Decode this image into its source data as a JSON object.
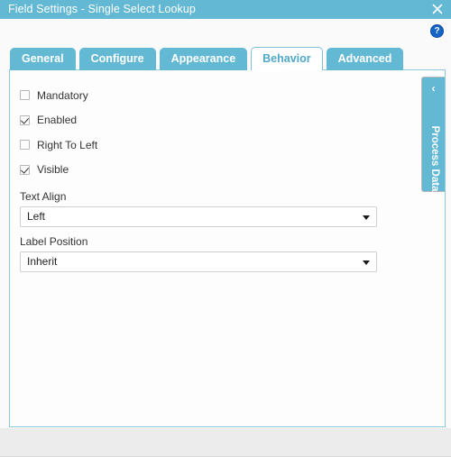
{
  "window": {
    "title": "Field Settings - Single Select Lookup",
    "close_icon": "close-icon",
    "help_icon": "help-icon",
    "help_glyph": "?"
  },
  "tabs": [
    {
      "label": "General",
      "active": false
    },
    {
      "label": "Configure",
      "active": false
    },
    {
      "label": "Appearance",
      "active": false
    },
    {
      "label": "Behavior",
      "active": true
    },
    {
      "label": "Advanced",
      "active": false
    }
  ],
  "form": {
    "checkboxes": [
      {
        "label": "Mandatory",
        "checked": false
      },
      {
        "label": "Enabled",
        "checked": true
      },
      {
        "label": "Right To Left",
        "checked": false
      },
      {
        "label": "Visible",
        "checked": true
      }
    ],
    "fields": [
      {
        "label": "Text Align",
        "value": "Left"
      },
      {
        "label": "Label Position",
        "value": "Inherit"
      }
    ]
  },
  "side_panel": {
    "label": "Process Data",
    "chevron": "‹",
    "chevron_icon": "chevron-left-icon"
  },
  "colors": {
    "accent": "#63b8d4",
    "accent_border": "#8fc9dd",
    "active_tab_text": "#4fa8c8",
    "help_blue": "#1565c8",
    "window_bg": "#ececec"
  }
}
